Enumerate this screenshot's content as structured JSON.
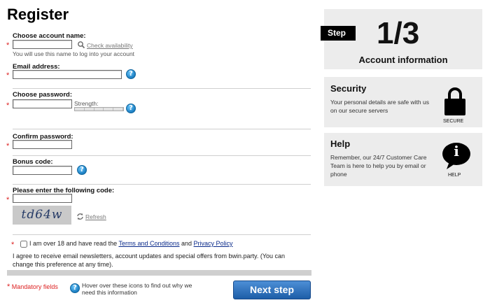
{
  "page": {
    "title": "Register"
  },
  "form": {
    "account_name": {
      "label": "Choose account name:",
      "value": "",
      "check_link": "Check availability",
      "hint": "You will use this name to log into your account"
    },
    "email": {
      "label": "Email address:",
      "value": ""
    },
    "password": {
      "label": "Choose password:",
      "value": "",
      "strength_label": "Strength:"
    },
    "confirm": {
      "label": "Confirm password:",
      "value": ""
    },
    "bonus": {
      "label": "Bonus code:",
      "value": ""
    },
    "captcha": {
      "label": "Please enter the following code:",
      "value": "",
      "image_text": "td64w",
      "refresh": "Refresh"
    },
    "terms": {
      "prefix": "I am over 18 and have read the",
      "terms_link": "Terms and Conditions",
      "and": "and",
      "privacy_link": "Privacy Policy"
    },
    "newsletter": "I agree to receive email newsletters, account updates and special offers from bwin.party. (You can change this preference at any time).",
    "required_marker": "*",
    "help_marker": "?",
    "mandatory_note": "Mandatory fields",
    "help_note": "Hover over these icons to find out why we need this information",
    "submit": "Next step"
  },
  "sidebar": {
    "step_badge": "Step",
    "step_value": "1/3",
    "step_caption": "Account information",
    "security": {
      "title": "Security",
      "text": "Your personal details are safe with us on our secure servers",
      "icon_label": "SECURE"
    },
    "help": {
      "title": "Help",
      "text": "Remember, our 24/7 Customer Care Team is here to help you by email or phone",
      "icon_label": "HELP",
      "icon_glyph": "i"
    }
  },
  "colors": {
    "button": "#1d5ea8",
    "required": "#dd2222",
    "panel_bg": "#ececec",
    "step_badge": "#000000"
  }
}
